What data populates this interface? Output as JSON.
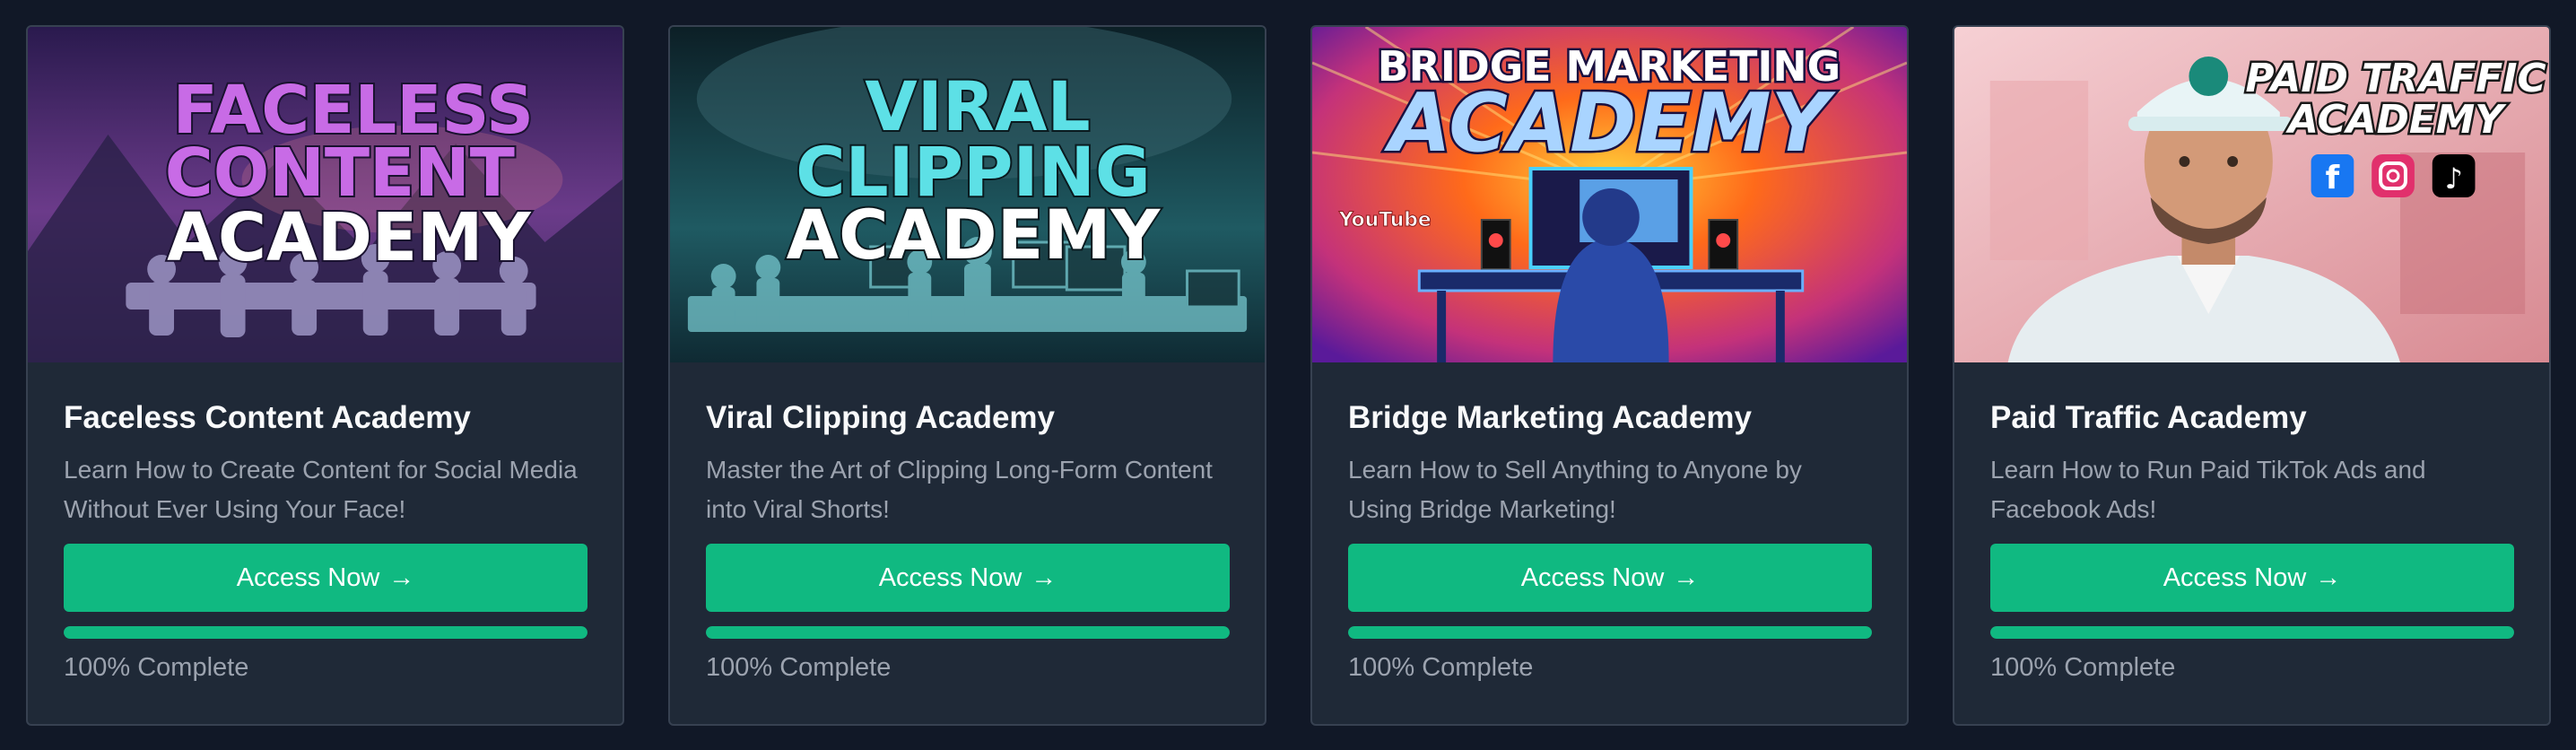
{
  "courses": [
    {
      "thumbnail": {
        "lines": [
          "FACELESS",
          "CONTENT",
          "ACADEMY"
        ],
        "colors": [
          "#c86be6",
          "#c86be6",
          "#ffffff"
        ],
        "bg_top": "#3a2266",
        "bg_bottom": "#6b3b8a",
        "accent": "#e07a8a"
      },
      "title": "Faceless Content Academy",
      "description": "Learn How to Create Content for Social Media Without Ever Using Your Face!",
      "button_label": "Access Now",
      "button_arrow": "→",
      "progress": 1.0,
      "progress_text": "100% Complete"
    },
    {
      "thumbnail": {
        "lines": [
          "VIRAL",
          "CLIPPING",
          "ACADEMY"
        ],
        "colors": [
          "#5de0e6",
          "#5de0e6",
          "#ffffff"
        ],
        "bg_top": "#0f2a33",
        "bg_bottom": "#1f5a62",
        "accent": "#3fb6c0"
      },
      "title": "Viral Clipping Academy",
      "description": "Master the Art of Clipping Long-Form Content into Viral Shorts!",
      "button_label": "Access Now",
      "button_arrow": "→",
      "progress": 1.0,
      "progress_text": "100% Complete"
    },
    {
      "thumbnail": {
        "lines": [
          "BRIDGE MARKETING",
          "ACADEMY"
        ],
        "colors": [
          "#ffffff",
          "#a9d4ff"
        ],
        "bg_top": "#ff6a1a",
        "bg_bottom": "#8a1fa8",
        "accent": "#ffd23a",
        "badge": "YouTube"
      },
      "title": "Bridge Marketing Academy",
      "description": "Learn How to Sell Anything to Anyone by Using Bridge Marketing!",
      "button_label": "Access Now",
      "button_arrow": "→",
      "progress": 1.0,
      "progress_text": "100% Complete"
    },
    {
      "thumbnail": {
        "lines": [
          "PAID TRAFFIC",
          "ACADEMY"
        ],
        "colors": [
          "#ffffff",
          "#ffffff"
        ],
        "bg_top": "#f4c4c8",
        "bg_bottom": "#d88a92",
        "accent": "#1877f2"
      },
      "title": "Paid Traffic Academy",
      "description": "Learn How to Run Paid TikTok Ads and Facebook Ads!",
      "button_label": "Access Now",
      "button_arrow": "→",
      "progress": 1.0,
      "progress_text": "100% Complete"
    }
  ]
}
